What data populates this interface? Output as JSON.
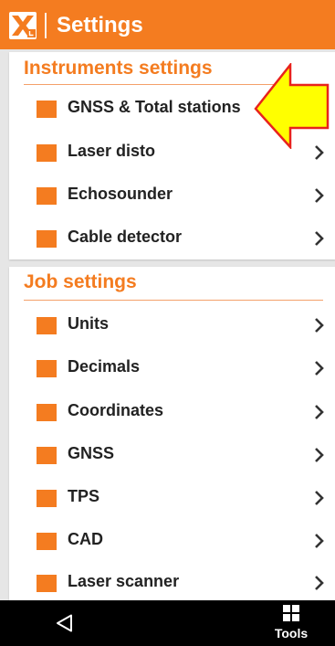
{
  "app": {
    "title": "Settings",
    "brand_color": "#f47c20",
    "logo_icon": "app-logo-icon"
  },
  "instruments": {
    "heading": "Instruments settings",
    "items": [
      {
        "label": "GNSS & Total stations",
        "icon": "orange-square-icon",
        "chevron": false
      },
      {
        "label": "Laser disto",
        "icon": "orange-square-icon",
        "chevron": true
      },
      {
        "label": "Echosounder",
        "icon": "orange-square-icon",
        "chevron": true
      },
      {
        "label": "Cable detector",
        "icon": "orange-square-icon",
        "chevron": true
      }
    ]
  },
  "job": {
    "heading": "Job settings",
    "items": [
      {
        "label": "Units",
        "icon": "orange-square-icon",
        "chevron": true
      },
      {
        "label": "Decimals",
        "icon": "orange-square-icon",
        "chevron": true
      },
      {
        "label": "Coordinates",
        "icon": "orange-square-icon",
        "chevron": true
      },
      {
        "label": "GNSS",
        "icon": "orange-square-icon",
        "chevron": true
      },
      {
        "label": "TPS",
        "icon": "orange-square-icon",
        "chevron": true
      },
      {
        "label": "CAD",
        "icon": "orange-square-icon",
        "chevron": true
      },
      {
        "label": "Laser scanner",
        "icon": "orange-square-icon",
        "chevron": true
      }
    ]
  },
  "annotation": {
    "icon": "yellow-pointer-arrow-icon",
    "fill_color": "#ffff00",
    "stroke_color": "#e8221c"
  },
  "navbar": {
    "back_icon": "back-triangle-icon",
    "tools_icon": "grid-icon",
    "tools_label": "Tools"
  }
}
